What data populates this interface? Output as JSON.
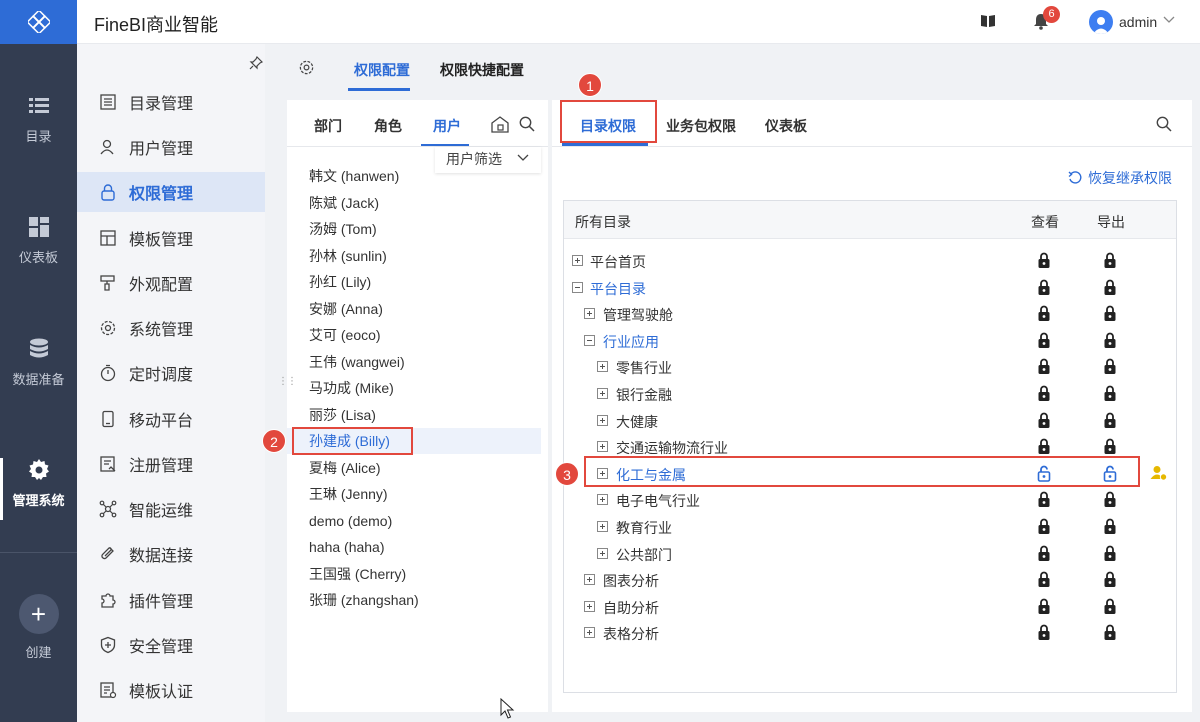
{
  "app": {
    "title": "FineBI商业智能"
  },
  "header": {
    "notification_count": "6",
    "user_name": "admin"
  },
  "rail": {
    "items": [
      {
        "label": "目录",
        "icon": "list-icon"
      },
      {
        "label": "仪表板",
        "icon": "dashboard-icon"
      },
      {
        "label": "数据准备",
        "icon": "database-icon"
      },
      {
        "label": "管理系统",
        "icon": "gear-icon"
      },
      {
        "label": "创建",
        "icon": "plus-icon"
      }
    ],
    "active": "管理系统"
  },
  "menu": {
    "items": [
      {
        "label": "目录管理",
        "icon": "list-icon"
      },
      {
        "label": "用户管理",
        "icon": "user-icon"
      },
      {
        "label": "权限管理",
        "icon": "lock-icon"
      },
      {
        "label": "模板管理",
        "icon": "template-icon"
      },
      {
        "label": "外观配置",
        "icon": "brush-icon"
      },
      {
        "label": "系统管理",
        "icon": "gear-icon"
      },
      {
        "label": "定时调度",
        "icon": "timer-icon"
      },
      {
        "label": "移动平台",
        "icon": "mobile-icon"
      },
      {
        "label": "注册管理",
        "icon": "register-icon"
      },
      {
        "label": "智能运维",
        "icon": "network-icon"
      },
      {
        "label": "数据连接",
        "icon": "link-icon"
      },
      {
        "label": "插件管理",
        "icon": "puzzle-icon"
      },
      {
        "label": "安全管理",
        "icon": "shield-icon"
      },
      {
        "label": "模板认证",
        "icon": "certificate-icon"
      }
    ],
    "active": "权限管理"
  },
  "top_tabs": {
    "config": "权限配置",
    "quick": "权限快捷配置"
  },
  "user_panel": {
    "tabs": {
      "dept": "部门",
      "role": "角色",
      "user": "用户"
    },
    "filter_label": "用户筛选",
    "users": [
      "韩文 (hanwen)",
      "陈斌 (Jack)",
      "汤姆 (Tom)",
      "孙林 (sunlin)",
      "孙红 (Lily)",
      "安娜 (Anna)",
      "艾可 (eoco)",
      "王伟 (wangwei)",
      "马功成 (Mike)",
      "丽莎 (Lisa)",
      "孙建成 (Billy)",
      "夏梅 (Alice)",
      "王琳 (Jenny)",
      "demo (demo)",
      "haha (haha)",
      "王国强 (Cherry)",
      "张珊 (zhangshan)"
    ],
    "selected": "孙建成 (Billy)"
  },
  "right_panel": {
    "tabs": {
      "catalog": "目录权限",
      "package": "业务包权限",
      "dashboard": "仪表板"
    },
    "restore_label": "恢复继承权限",
    "columns": {
      "all": "所有目录",
      "view": "查看",
      "export": "导出"
    },
    "tree": [
      {
        "label": "平台首页",
        "level": 0,
        "expander": "plus",
        "view": "locked",
        "export": "locked"
      },
      {
        "label": "平台目录",
        "level": 0,
        "expander": "minus",
        "view": "locked",
        "export": "locked",
        "highlight": true
      },
      {
        "label": "管理驾驶舱",
        "level": 1,
        "expander": "plus",
        "view": "locked",
        "export": "locked"
      },
      {
        "label": "行业应用",
        "level": 1,
        "expander": "minus",
        "view": "locked",
        "export": "locked",
        "highlight": true
      },
      {
        "label": "零售行业",
        "level": 2,
        "expander": "plus",
        "view": "locked",
        "export": "locked"
      },
      {
        "label": "银行金融",
        "level": 2,
        "expander": "plus",
        "view": "locked",
        "export": "locked"
      },
      {
        "label": "大健康",
        "level": 2,
        "expander": "plus",
        "view": "locked",
        "export": "locked"
      },
      {
        "label": "交通运输物流行业",
        "level": 2,
        "expander": "plus",
        "view": "locked",
        "export": "locked"
      },
      {
        "label": "化工与金属",
        "level": 2,
        "expander": "plus",
        "view": "unlocked",
        "export": "unlocked",
        "highlight": true,
        "user_badge": true
      },
      {
        "label": "电子电气行业",
        "level": 2,
        "expander": "plus",
        "view": "locked",
        "export": "locked"
      },
      {
        "label": "教育行业",
        "level": 2,
        "expander": "plus",
        "view": "locked",
        "export": "locked"
      },
      {
        "label": "公共部门",
        "level": 2,
        "expander": "plus",
        "view": "locked",
        "export": "locked"
      },
      {
        "label": "图表分析",
        "level": 1,
        "expander": "plus",
        "view": "locked",
        "export": "locked"
      },
      {
        "label": "自助分析",
        "level": 1,
        "expander": "plus",
        "view": "locked",
        "export": "locked"
      },
      {
        "label": "表格分析",
        "level": 1,
        "expander": "plus",
        "view": "locked",
        "export": "locked"
      }
    ]
  },
  "annotations": [
    "1",
    "2",
    "3"
  ],
  "colors": {
    "accent": "#2e6cd6",
    "rail": "#333d51",
    "annotation": "#e2483d",
    "user_badge": "#e6b800"
  }
}
